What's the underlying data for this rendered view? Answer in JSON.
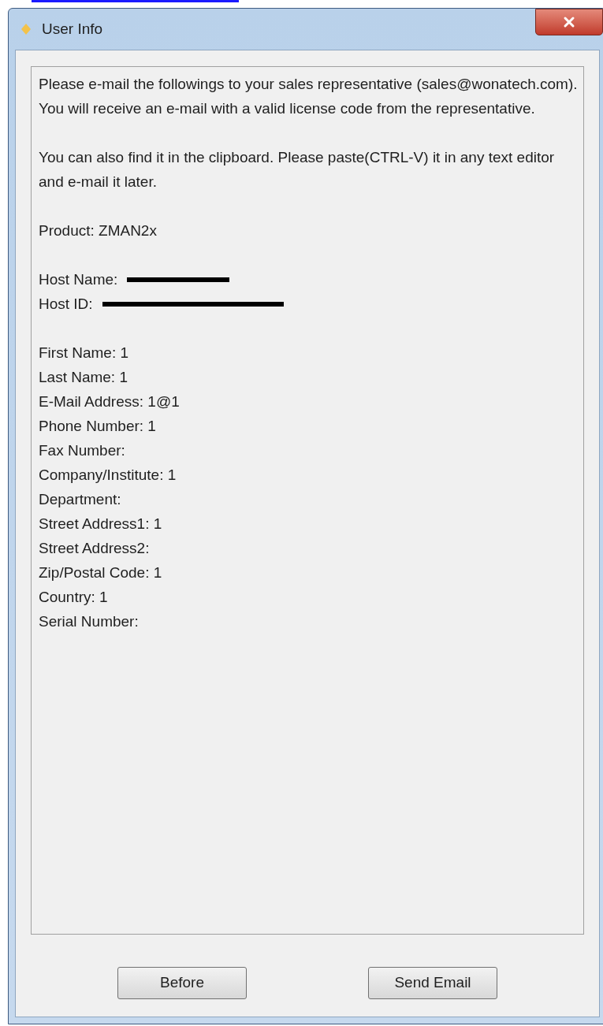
{
  "window": {
    "title": "User Info"
  },
  "message": {
    "paragraphs": [
      "Please e-mail the followings to your sales representative (sales@wonatech.com). You will receive an e-mail with a valid license code from the representative.",
      "You can also find it in the clipboard. Please paste(CTRL-V) it in any text editor and e-mail it later."
    ],
    "product": "Product:  ZMAN2x",
    "host_fields": [
      {
        "label": "Host Name:",
        "redacted": true
      },
      {
        "label": "Host ID:",
        "redacted": true
      }
    ],
    "fields": [
      "First Name: 1",
      "Last Name: 1",
      "E-Mail Address: 1@1",
      "Phone Number: 1",
      "Fax Number:",
      "Company/Institute: 1",
      "Department:",
      "Street Address1: 1",
      "Street Address2:",
      "Zip/Postal Code: 1",
      "Country: 1",
      "Serial Number:"
    ]
  },
  "buttons": [
    "Before",
    "Send Email"
  ]
}
